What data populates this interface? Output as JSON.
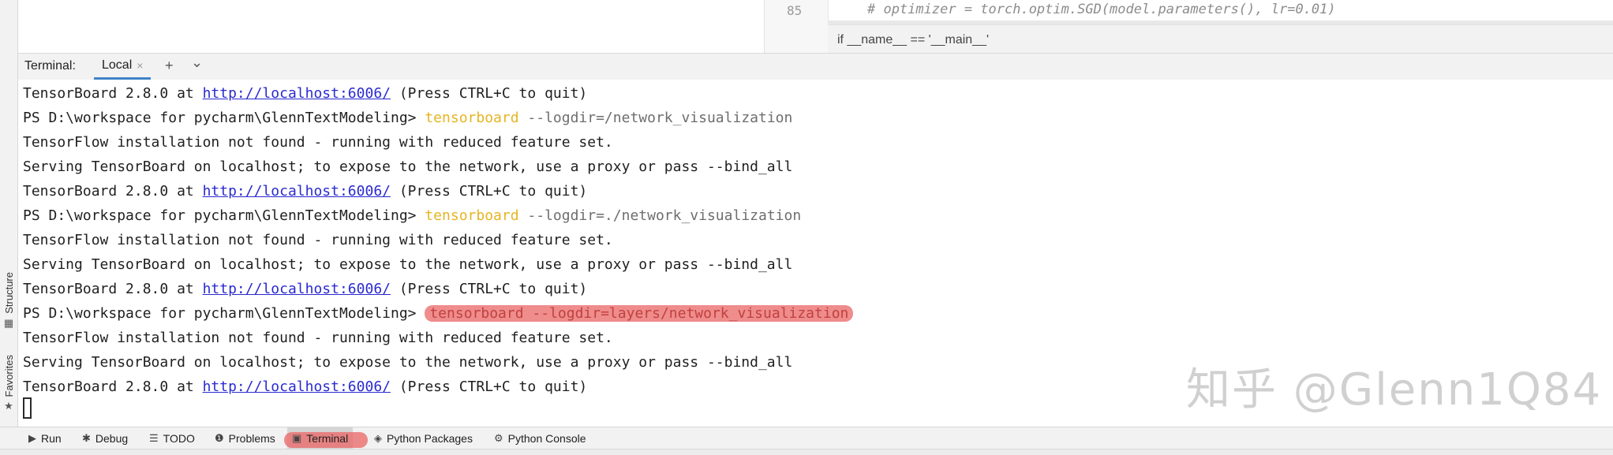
{
  "left_strip": {
    "structure_label": "Structure",
    "favorites_label": "Favorites"
  },
  "editor": {
    "line_number": "85",
    "code": "# optimizer = torch.optim.SGD(model.parameters(), lr=0.01)",
    "breadcrumb": "if __name__ == '__main__'"
  },
  "terminal_header": {
    "title": "Terminal:",
    "tab_label": "Local",
    "tab_close": "×",
    "add_button": "+",
    "dropdown_button": "⌄"
  },
  "terminal": {
    "lines": [
      {
        "type": "serve",
        "prefix": "TensorBoard 2.8.0 at ",
        "link": "http://localhost:6006/",
        "suffix": " (Press CTRL+C to quit)"
      },
      {
        "type": "prompt",
        "prompt": "PS D:\\workspace for pycharm\\GlennTextModeling> ",
        "cmd": "tensorboard",
        "args": " --logdir=/network_visualization"
      },
      {
        "type": "text",
        "text": "TensorFlow installation not found - running with reduced feature set."
      },
      {
        "type": "text",
        "text": "Serving TensorBoard on localhost; to expose to the network, use a proxy or pass --bind_all"
      },
      {
        "type": "serve",
        "prefix": "TensorBoard 2.8.0 at ",
        "link": "http://localhost:6006/",
        "suffix": " (Press CTRL+C to quit)"
      },
      {
        "type": "prompt",
        "prompt": "PS D:\\workspace for pycharm\\GlennTextModeling> ",
        "cmd": "tensorboard",
        "args": " --logdir=./network_visualization"
      },
      {
        "type": "text",
        "text": "TensorFlow installation not found - running with reduced feature set."
      },
      {
        "type": "text",
        "text": "Serving TensorBoard on localhost; to expose to the network, use a proxy or pass --bind_all"
      },
      {
        "type": "serve",
        "prefix": "TensorBoard 2.8.0 at ",
        "link": "http://localhost:6006/",
        "suffix": " (Press CTRL+C to quit)"
      },
      {
        "type": "prompt_hl",
        "prompt": "PS D:\\workspace for pycharm\\GlennTextModeling> ",
        "cmd": "tensorboard",
        "args": " --logdir=layers/network_visualization"
      },
      {
        "type": "text",
        "text": "TensorFlow installation not found - running with reduced feature set."
      },
      {
        "type": "text",
        "text": "Serving TensorBoard on localhost; to expose to the network, use a proxy or pass --bind_all"
      },
      {
        "type": "serve",
        "prefix": "TensorBoard 2.8.0 at ",
        "link": "http://localhost:6006/",
        "suffix": " (Press CTRL+C to quit)"
      }
    ]
  },
  "watermark": "知乎 @Glenn1Q84",
  "toolbar": {
    "run": "Run",
    "debug": "Debug",
    "todo": "TODO",
    "problems": "Problems",
    "terminal": "Terminal",
    "python_packages": "Python Packages",
    "python_console": "Python Console"
  },
  "colors": {
    "command": "#e6b422",
    "link": "#2a2ad0",
    "highlight": "#ef8c8c"
  }
}
